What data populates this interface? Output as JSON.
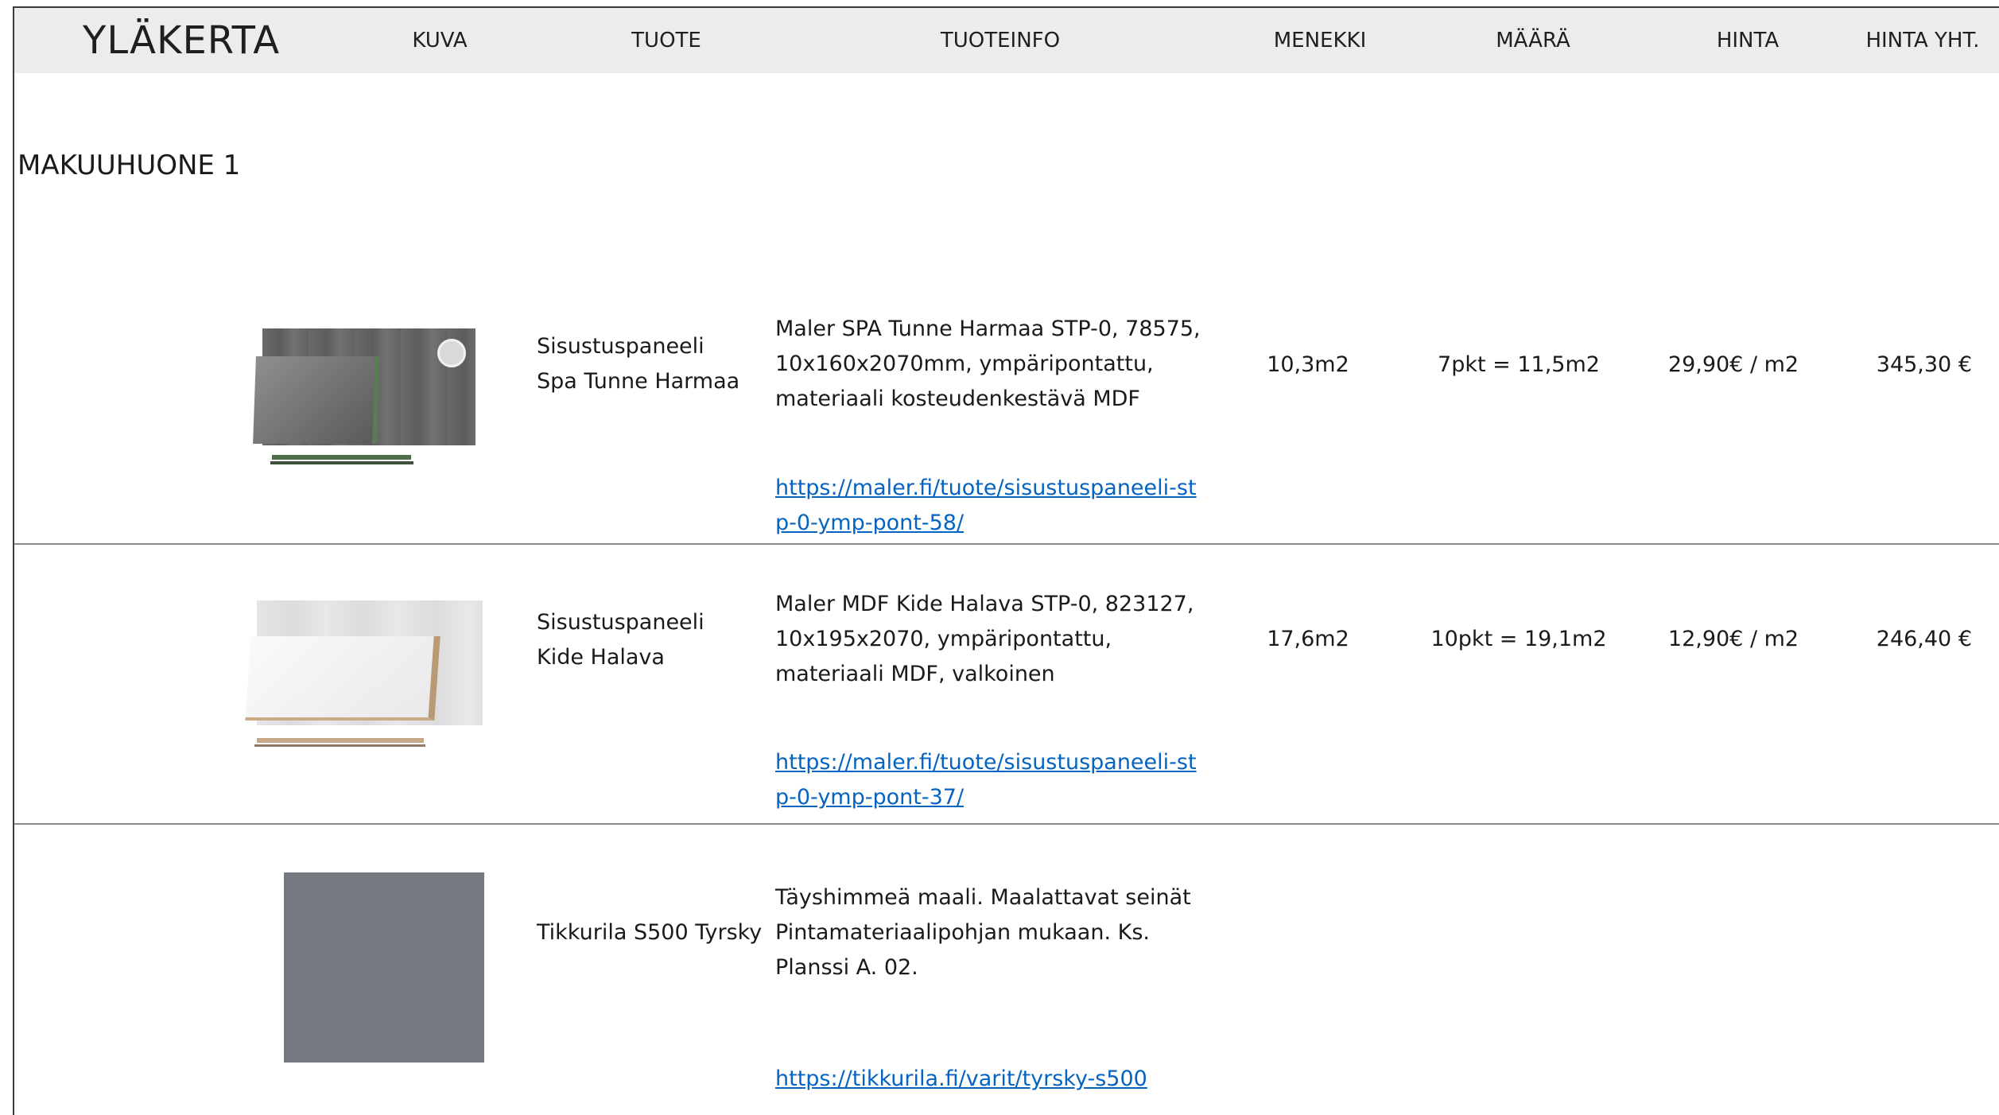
{
  "header": {
    "title": "YLÄKERTA",
    "columns": {
      "kuva": "KUVA",
      "tuote": "TUOTE",
      "tuoteinfo": "TUOTEINFO",
      "menekki": "MENEKKI",
      "maara": "MÄÄRÄ",
      "hinta": "HINTA",
      "hinta_yht": "HINTA YHT."
    }
  },
  "section": {
    "title": "MAKUUHUONE 1"
  },
  "rows": [
    {
      "image": "grey-wall-panel-image",
      "product": "Sisustuspaneeli Spa Tunne Harmaa",
      "info": "Maler SPA Tunne Harmaa STP-0, 78575, 10x160x2070mm, ympäripontattu, materiaali kosteudenkestävä MDF",
      "link": "https://maler.fi/tuote/sisustuspaneeli-stp-0-ymp-pont-58/",
      "menekki": "10,3m2",
      "maara": "7pkt = 11,5m2",
      "hinta": "29,90€ / m2",
      "hinta_yht": "345,30 €"
    },
    {
      "image": "white-wall-panel-image",
      "product": "Sisustuspaneeli Kide Halava",
      "info": "Maler MDF Kide Halava STP-0, 823127, 10x195x2070, ympäripontattu, materiaali MDF, valkoinen",
      "link": "https://maler.fi/tuote/sisustuspaneeli-stp-0-ymp-pont-37/",
      "menekki": "17,6m2",
      "maara": "10pkt = 19,1m2",
      "hinta": "12,90€ / m2",
      "hinta_yht": "246,40 €"
    },
    {
      "image": "paint-color-swatch",
      "swatch_color": "#757a80",
      "product": "Tikkurila S500 Tyrsky",
      "info": "Täyshimmeä maali. Maalattavat seinät Pintamateriaalipohjan mukaan. Ks. Planssi A. 02.",
      "link": "https://tikkurila.fi/varit/tyrsky-s500",
      "menekki": "",
      "maara": "",
      "hinta": "",
      "hinta_yht": ""
    }
  ],
  "colors": {
    "header_bg": "#ececec",
    "link": "#0563c1",
    "divider": "#8a8a8a"
  }
}
